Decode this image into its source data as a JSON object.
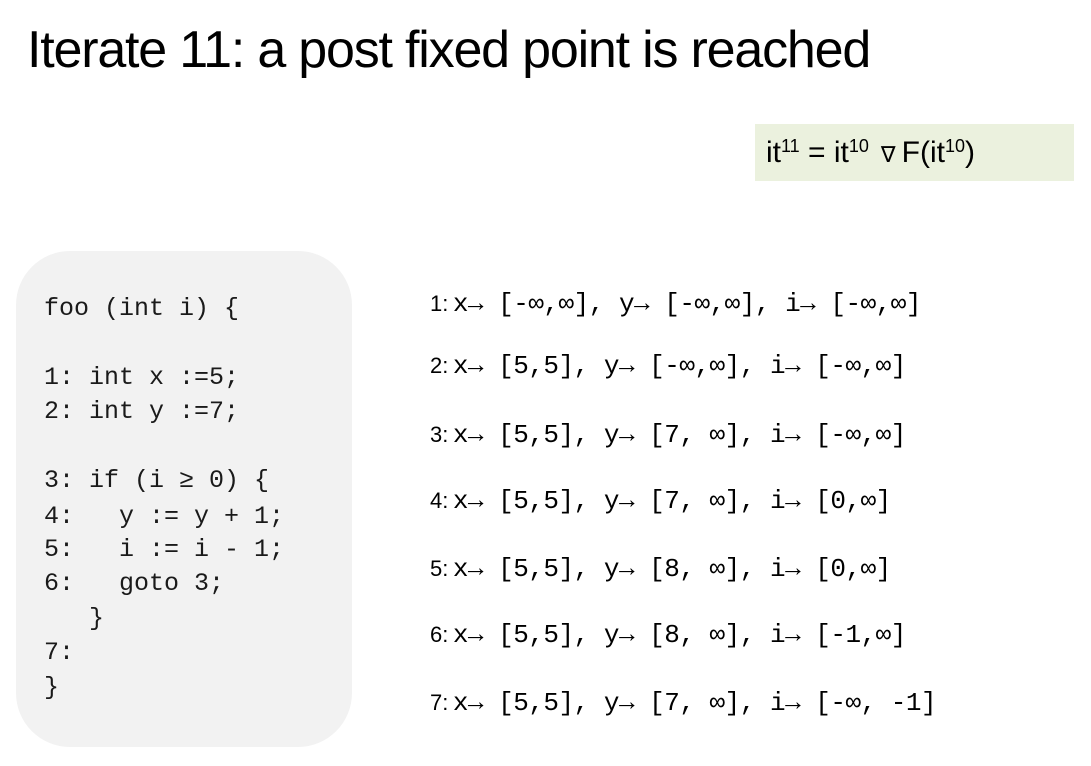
{
  "slide": {
    "title": "Iterate 11: a post fixed point is reached"
  },
  "formula": {
    "lhs": "it",
    "lhs_sup": "11",
    "eq": " = ",
    "arg1": "it",
    "arg1_sup": "10",
    "operator": "∇",
    "func_open": "F(it",
    "arg2_sup": "10",
    "func_close": ")"
  },
  "code": {
    "lines": [
      "foo (int i) {",
      "1: int x :=5;",
      "2: int y :=7;",
      "3: if (i ≥ 0) {",
      "4:   y := y + 1;",
      "5:   i := i - 1;",
      "6:   goto 3;",
      "   }",
      "7:",
      "}"
    ]
  },
  "states": [
    {
      "label": "1:",
      "expr": "x→ [-∞,∞],  y→ [-∞,∞],  i→ [-∞,∞]"
    },
    {
      "label": "2:",
      "expr": "x→ [5,5],  y→ [-∞,∞],  i→ [-∞,∞]"
    },
    {
      "label": "3:",
      "expr": "x→ [5,5],  y→ [7, ∞],  i→ [-∞,∞]"
    },
    {
      "label": "4:",
      "expr": "x→ [5,5],  y→ [7, ∞],  i→ [0,∞]"
    },
    {
      "label": "5:",
      "expr": "x→ [5,5],  y→ [8, ∞],  i→ [0,∞]"
    },
    {
      "label": "6:",
      "expr": "x→ [5,5],  y→ [8, ∞],  i→ [-1,∞]"
    },
    {
      "label": "7:",
      "expr": "x→ [5,5],  y→ [7, ∞],  i→ [-∞, -1]"
    }
  ],
  "colors": {
    "formula_bg": "#ebf1de",
    "code_bg": "#f2f2f2"
  }
}
